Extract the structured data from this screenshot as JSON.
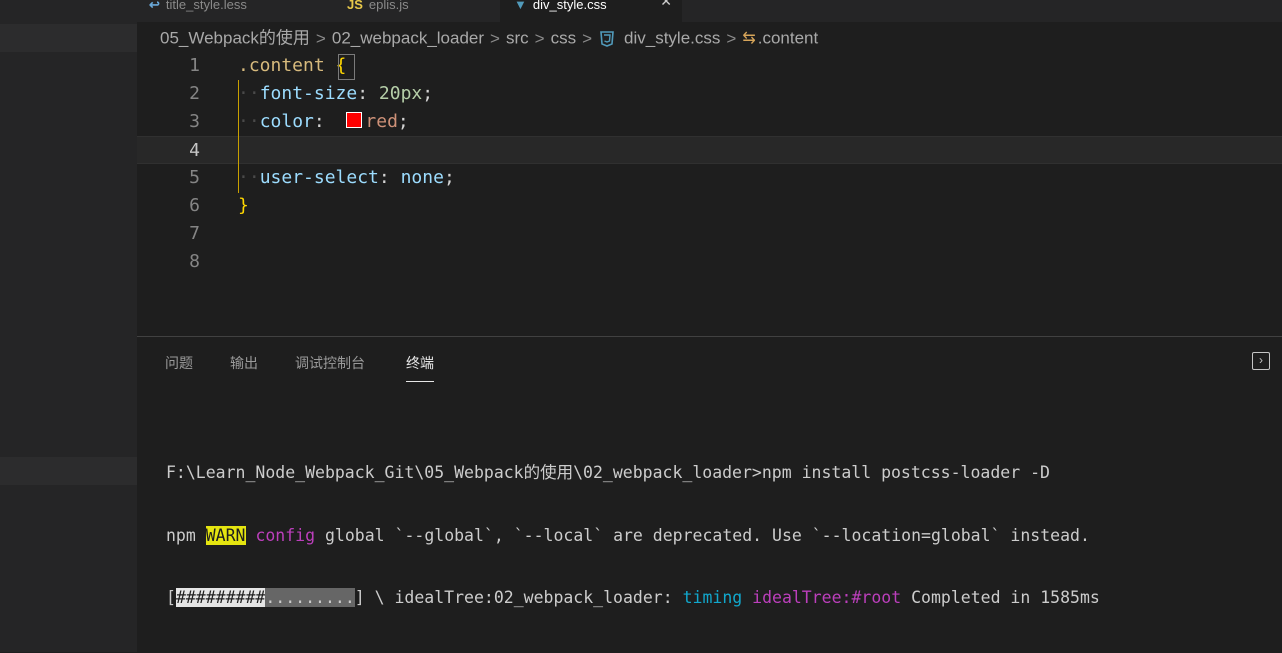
{
  "tabs": [
    {
      "icon": "",
      "label": "title_style.less"
    },
    {
      "icon": "JS",
      "label": "eplis.js"
    },
    {
      "icon": "",
      "label": "div_style.css",
      "close": "✕"
    }
  ],
  "breadcrumb": {
    "items": [
      "05_Webpack的使用",
      "02_webpack_loader",
      "src",
      "css"
    ],
    "file": "div_style.css",
    "symbol": ".content",
    "separator": ">"
  },
  "editor": {
    "line_numbers": [
      "1",
      "2",
      "3",
      "4",
      "5",
      "6",
      "7",
      "8"
    ],
    "current_line": 4,
    "line1": {
      "selector": ".content",
      "brace_open": "{"
    },
    "line2": {
      "prop": "font-size",
      "colon": ":",
      "value": "20px",
      "semi": ";"
    },
    "line3": {
      "prop": "color",
      "colon": ":",
      "value": "red",
      "semi": ";",
      "swatch_color": "#ff0000"
    },
    "line5": {
      "prop": "user-select",
      "colon": ":",
      "value": "none",
      "semi": ";"
    },
    "line6": {
      "brace_close": "}"
    }
  },
  "panel": {
    "tabs": [
      "问题",
      "输出",
      "调试控制台",
      "终端"
    ],
    "active_tab": "终端"
  },
  "terminal": {
    "line1": "F:\\Learn_Node_Webpack_Git\\05_Webpack的使用\\02_webpack_loader>npm install postcss-loader -D",
    "line2": {
      "npm": "npm",
      "warn": "WARN",
      "config": "config",
      "rest": "global `--global`, `--local` are deprecated. Use `--location=global` instead."
    },
    "line3": {
      "open": "[",
      "done": "#########",
      "rest": ".........",
      "close": "]",
      "spinner": "\\",
      "stage": "idealTree:02_webpack_loader:",
      "timing": "timing",
      "tree": "idealTree:#root",
      "completed": "Completed in 1585ms"
    }
  },
  "colors": {
    "background": "#1e1e1e",
    "sidebar": "#252526",
    "warn_bg": "#e5e510",
    "magenta": "#bc3fbc",
    "cyan": "#11a8cd"
  }
}
